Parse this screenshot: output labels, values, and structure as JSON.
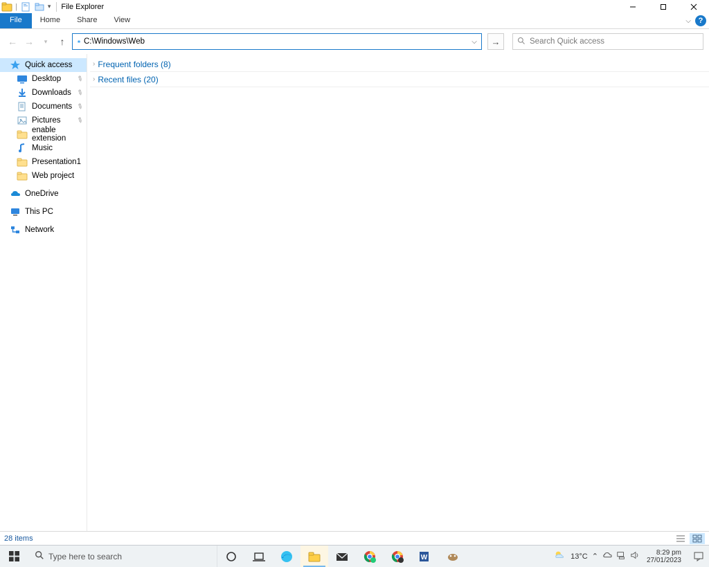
{
  "window": {
    "title": "File Explorer"
  },
  "ribbon": {
    "file": "File",
    "tabs": [
      "Home",
      "Share",
      "View"
    ]
  },
  "nav": {
    "address_value": "C:\\Windows\\Web",
    "search_placeholder": "Search Quick access"
  },
  "sidebar": {
    "quick_access": "Quick access",
    "quick_items": [
      {
        "label": "Desktop",
        "icon": "desktop",
        "pinned": true
      },
      {
        "label": "Downloads",
        "icon": "download",
        "pinned": true
      },
      {
        "label": "Documents",
        "icon": "document",
        "pinned": true
      },
      {
        "label": "Pictures",
        "icon": "pictures",
        "pinned": true
      },
      {
        "label": "enable extension",
        "icon": "folder",
        "pinned": false
      },
      {
        "label": "Music",
        "icon": "music",
        "pinned": false
      },
      {
        "label": "Presentation1",
        "icon": "folder",
        "pinned": false
      },
      {
        "label": "Web project",
        "icon": "folder",
        "pinned": false
      }
    ],
    "onedrive": "OneDrive",
    "this_pc": "This PC",
    "network": "Network"
  },
  "content": {
    "frequent_label": "Frequent folders (8)",
    "recent_label": "Recent files (20)"
  },
  "statusbar": {
    "count_label": "28 items"
  },
  "taskbar": {
    "search_placeholder": "Type here to search",
    "weather_temp": "13°C",
    "time": "8:29 pm",
    "date": "27/01/2023"
  }
}
